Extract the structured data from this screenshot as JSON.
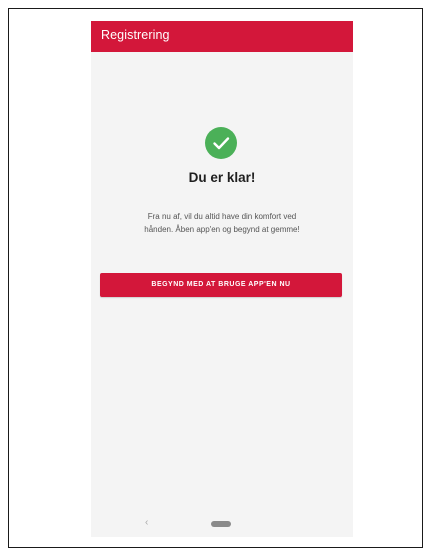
{
  "appbar": {
    "title": "Registrering",
    "color": "#d3173a"
  },
  "status": {
    "icon": "check-circle-icon",
    "color": "#4bb058"
  },
  "main": {
    "headline": "Du er klar!",
    "body": "Fra nu af, vil du altid have din komfort ved hånden. Åben app'en og begynd at gemme!",
    "cta_label": "BEGYND MED AT BRUGE APP'EN NU"
  },
  "navbar": {
    "back_glyph": "‹",
    "back_icon": "back-chevron-icon",
    "home_icon": "home-pill-icon"
  }
}
